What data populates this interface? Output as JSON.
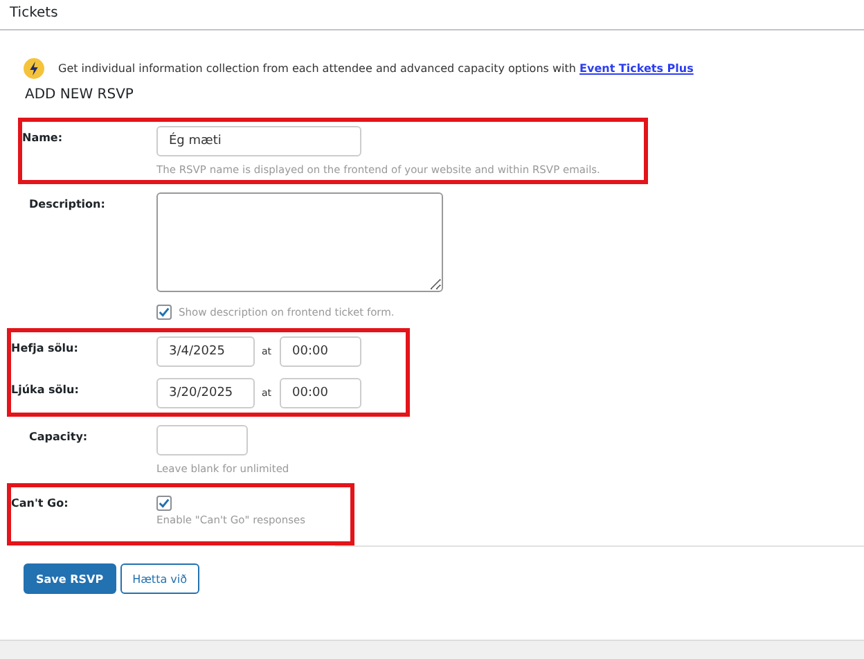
{
  "panel": {
    "title": "Tickets"
  },
  "notice": {
    "text": "Get individual information collection from each attendee and advanced capacity options with",
    "link": "Event Tickets Plus"
  },
  "heading": "ADD NEW RSVP",
  "sections": [
    {
      "highlighted": true,
      "fields": [
        {
          "kind": "text",
          "label": "Name:",
          "value": "Ég mæti",
          "help": "The RSVP name is displayed on the frontend of your website and within RSVP emails."
        }
      ]
    },
    {
      "highlighted": false,
      "fields": [
        {
          "kind": "textarea",
          "label": "Description:",
          "checkbox": {
            "label": "Show description on frontend ticket form.",
            "checked": true
          }
        }
      ]
    },
    {
      "highlighted": true,
      "fields": [
        {
          "kind": "datetime",
          "label": "Hefja sölu:",
          "date": "3/4/2025",
          "at": "at",
          "time": "00:00"
        },
        {
          "kind": "datetime",
          "label": "Ljúka sölu:",
          "date": "3/20/2025",
          "at": "at",
          "time": "00:00"
        }
      ]
    },
    {
      "highlighted": false,
      "fields": [
        {
          "kind": "small",
          "label": "Capacity:",
          "help": "Leave blank for unlimited"
        }
      ]
    },
    {
      "highlighted": true,
      "fields": [
        {
          "kind": "check",
          "label": "Can't Go:",
          "checked": true,
          "help": "Enable \"Can't Go\" responses"
        }
      ]
    }
  ],
  "buttons": [
    {
      "label": "Save RSVP",
      "primary": true
    },
    {
      "label": "Hætta við",
      "primary": false
    }
  ]
}
